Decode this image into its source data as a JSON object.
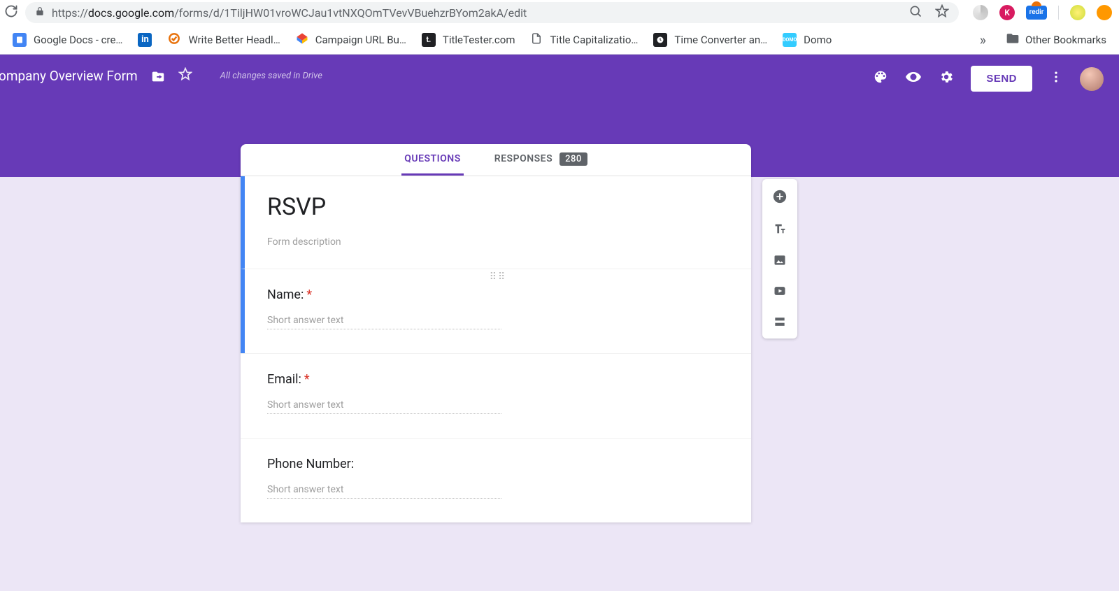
{
  "browser": {
    "url_host": "docs.google.com",
    "url_path": "/forms/d/1TiljHW01vroWCJau1vtNXQOmTVevVBuehzrBYom2akA/edit"
  },
  "bookmarks": [
    {
      "label": "Google Docs - cre…",
      "color": "#4285f4"
    },
    {
      "label": "",
      "color": "#0a66c2"
    },
    {
      "label": "Write Better Headl…",
      "color": "#e8710a"
    },
    {
      "label": "Campaign URL Bu…",
      "color": "#ffffff"
    },
    {
      "label": "TitleTester.com",
      "color": "#202124"
    },
    {
      "label": "Title Capitalizatio…",
      "color": "#ffffff"
    },
    {
      "label": "Time Converter an…",
      "color": "#202124"
    },
    {
      "label": "Domo",
      "color": "#33ccff"
    }
  ],
  "bookmarks_overflow": "»",
  "other_bookmarks_label": "Other Bookmarks",
  "header": {
    "doc_title": "ompany Overview Form",
    "drive_status": "All changes saved in Drive",
    "send_label": "SEND"
  },
  "tabs": {
    "questions": "QUESTIONS",
    "responses": "RESPONSES",
    "responses_count": "280"
  },
  "form": {
    "title": "RSVP",
    "description_placeholder": "Form description",
    "questions": [
      {
        "label": "Name:",
        "required": true,
        "answer_hint": "Short answer text"
      },
      {
        "label": "Email:",
        "required": true,
        "answer_hint": "Short answer text"
      },
      {
        "label": "Phone Number:",
        "required": false,
        "answer_hint": "Short answer text"
      }
    ]
  },
  "required_marker": "*"
}
